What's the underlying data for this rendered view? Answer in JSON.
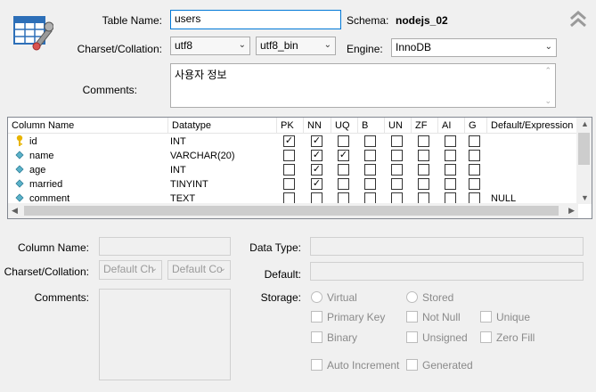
{
  "table": {
    "name_label": "Table Name:",
    "name_value": "users",
    "schema_label": "Schema:",
    "schema_value": "nodejs_02",
    "charset_label": "Charset/Collation:",
    "charset_value": "utf8",
    "collation_value": "utf8_bin",
    "engine_label": "Engine:",
    "engine_value": "InnoDB",
    "comments_label": "Comments:",
    "comments_value": "사용자 정보"
  },
  "grid": {
    "headers": [
      "Column Name",
      "Datatype",
      "PK",
      "NN",
      "UQ",
      "B",
      "UN",
      "ZF",
      "AI",
      "G",
      "Default/Expression"
    ],
    "rows": [
      {
        "name": "id",
        "type": "INT",
        "pk": true,
        "nn": true,
        "uq": false,
        "default": "",
        "icon": "key"
      },
      {
        "name": "name",
        "type": "VARCHAR(20)",
        "pk": false,
        "nn": true,
        "uq": true,
        "default": "",
        "icon": "diamond"
      },
      {
        "name": "age",
        "type": "INT",
        "pk": false,
        "nn": true,
        "uq": false,
        "default": "",
        "icon": "diamond"
      },
      {
        "name": "married",
        "type": "TINYINT",
        "pk": false,
        "nn": true,
        "uq": false,
        "default": "",
        "icon": "diamond"
      },
      {
        "name": "comment",
        "type": "TEXT",
        "pk": false,
        "nn": false,
        "uq": false,
        "default": "NULL",
        "icon": "diamond"
      }
    ]
  },
  "details": {
    "column_name_label": "Column Name:",
    "charset_label": "Charset/Collation:",
    "charset_placeholder": "Default Ch",
    "collation_placeholder": "Default Co",
    "comments_label": "Comments:",
    "datatype_label": "Data Type:",
    "default_label": "Default:",
    "storage_label": "Storage:",
    "virtual_label": "Virtual",
    "stored_label": "Stored",
    "primary_key_label": "Primary Key",
    "not_null_label": "Not Null",
    "unique_label": "Unique",
    "binary_label": "Binary",
    "unsigned_label": "Unsigned",
    "zero_fill_label": "Zero Fill",
    "auto_increment_label": "Auto Increment",
    "generated_label": "Generated"
  },
  "icons": {
    "table_icon": "table-wrench-icon",
    "collapse": "double-chevron-up-icon"
  },
  "colors": {
    "focus_border": "#0078d7",
    "key_icon": "#e8b400",
    "diamond_icon": "#5bb2c9"
  }
}
